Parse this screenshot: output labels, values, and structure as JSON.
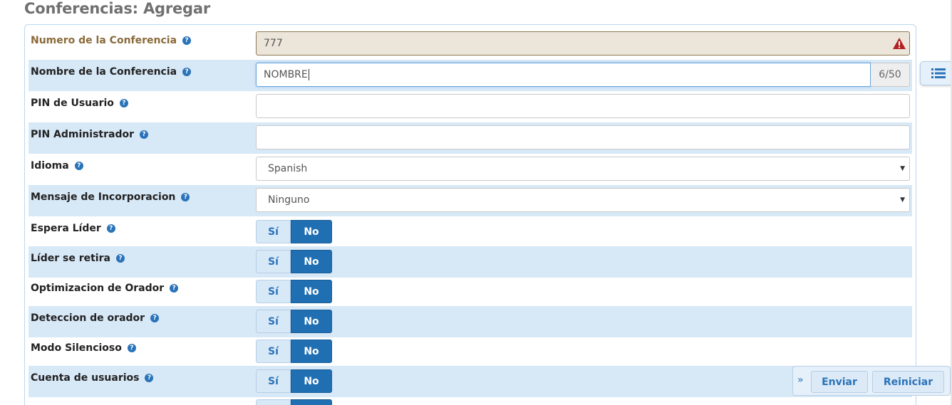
{
  "page": {
    "title": "Conferencias: Agregar"
  },
  "form": {
    "numero": {
      "label": "Numero de la Conferencia",
      "value": "777"
    },
    "nombre": {
      "label": "Nombre de la Conferencia",
      "value": "NOMBRE",
      "counter": "6/50"
    },
    "pin_usuario": {
      "label": "PIN de Usuario",
      "value": ""
    },
    "pin_admin": {
      "label": "PIN Administrador",
      "value": ""
    },
    "idioma": {
      "label": "Idioma",
      "selected": "Spanish"
    },
    "mensaje": {
      "label": "Mensaje de Incorporacion",
      "selected": "Ninguno"
    },
    "toggles": [
      {
        "label": "Espera Líder",
        "yes": "Sí",
        "no": "No",
        "selected": "No"
      },
      {
        "label": "Líder se retira",
        "yes": "Sí",
        "no": "No",
        "selected": "No"
      },
      {
        "label": "Optimizacion de Orador",
        "yes": "Sí",
        "no": "No",
        "selected": "No"
      },
      {
        "label": "Deteccion de orador",
        "yes": "Sí",
        "no": "No",
        "selected": "No"
      },
      {
        "label": "Modo Silencioso",
        "yes": "Sí",
        "no": "No",
        "selected": "No"
      },
      {
        "label": "Cuenta de usuarios",
        "yes": "Sí",
        "no": "No",
        "selected": "No"
      }
    ]
  },
  "actions": {
    "submit": "Enviar",
    "reset": "Reiniciar"
  },
  "colors": {
    "accent": "#1f6fb2",
    "row_alt": "#d7e8f7",
    "warning": "#b22222"
  },
  "icons": {
    "help": "question-circle-icon",
    "warning": "warning-triangle-icon",
    "side_tab": "list-icon",
    "chevron": "double-chevron-right-icon"
  }
}
